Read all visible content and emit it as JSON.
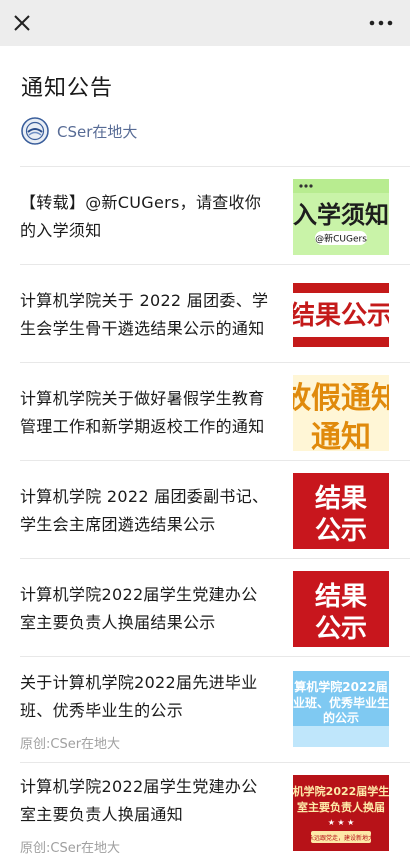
{
  "header": {
    "close_icon": "close-icon",
    "more_icon": "more-icon"
  },
  "page": {
    "title": "通知公告"
  },
  "account": {
    "name": "CSer在地大"
  },
  "items": [
    {
      "title_line1": "【转载】@新CUGers，请查收你",
      "title_line2": "的入学须知",
      "meta": "",
      "thumb_text": "入学须知",
      "thumb_sub": "@新CUGers"
    },
    {
      "title_line1": "计算机学院关于 2022 届团委、学",
      "title_line2": "生会学生骨干遴选结果公示的通知",
      "meta": "",
      "thumb_text": "结果公示"
    },
    {
      "title_line1": "计算机学院关于做好暑假学生教育",
      "title_line2": "管理工作和新学期返校工作的通知",
      "meta": "",
      "thumb_text": "放假通知"
    },
    {
      "title_line1": "计算机学院 2022 届团委副书记、",
      "title_line2": "学生会主席团遴选结果公示",
      "meta": "",
      "thumb_text1": "结果",
      "thumb_text2": "公示"
    },
    {
      "title_line1": "计算机学院2022届学生党建办公",
      "title_line2": "室主要负责人换届结果公示",
      "meta": "",
      "thumb_text1": "结果",
      "thumb_text2": "公示"
    },
    {
      "title_line1": "关于计算机学院2022届先进毕业",
      "title_line2": "班、优秀毕业生的公示",
      "meta": "原创:CSer在地大",
      "thumb_text1": "算机学院2022届",
      "thumb_text2": "业班、优秀毕业生",
      "thumb_text3": "的公示"
    },
    {
      "title_line1": "计算机学院2022届学生党建办公",
      "title_line2": "室主要负责人换届通知",
      "meta": "原创:CSer在地大",
      "thumb_text1": "机学院2022届学生",
      "thumb_text2": "室主要负责人换届",
      "thumb_text3": "永远跟党走，建设新地大"
    }
  ]
}
